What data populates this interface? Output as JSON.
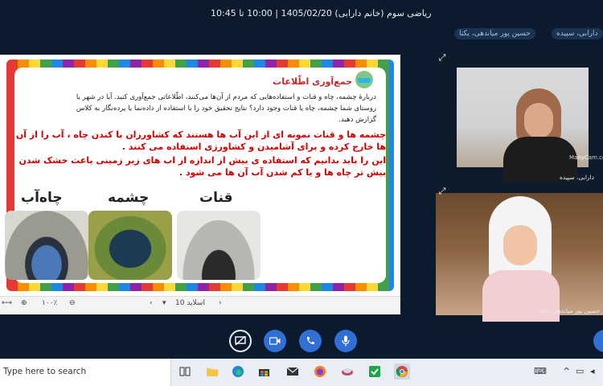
{
  "meeting": {
    "title": "ریاضی سوم (خانم دارابی) 1405/02/20 | 10:00 تا 10:45"
  },
  "participants_bar": {
    "chips": [
      "حسین پور میاندهی، یکتا",
      "دارابی، سپیده"
    ]
  },
  "slide": {
    "heading": "جمع‌آوری اطّلاعات",
    "paragraph": "دربارۀ چشمه، چاه و قنات و استفاده‌هایی که مردم از آن‌ها می‌کنند، اطّلاعاتی جمع‌آوری کنید. آیا در شهر یا روستای شما چشمه، چاه یا قنات وجود دارد؟ نتایج تحقیق خود را با استفاده از داده‌نما یا پرده‌نگار به کلاس گزارش دهید.",
    "red_text_1": "چشمه ها و قنات نمونه ای از این آب ها هستند که کشاورزان با کندن چاه ، آب را از آن ها خارج کرده و برای آشامیدن و کشاورزی استفاده می کنند .",
    "red_text_2": "این را باید بدانیم که استفاده ی بیش از اندازه از اب های زیر زمینی باعث خشک شدن بیش تر چاه ها و یا کم شدن آب آن ها می شود .",
    "labels": {
      "well": "چاه‌آب",
      "spring": "چشمه",
      "qanat": "قنات"
    }
  },
  "slide_toolbar": {
    "zoom": "۱۰۰٪",
    "slide_label": "اسلاید 10",
    "icons": [
      "fullscreen-arrows-icon",
      "zoom-in-icon",
      "zoom-out-icon",
      "chevron-left-icon",
      "chevron-down-icon",
      "chevron-right-icon"
    ]
  },
  "videos": [
    {
      "name": "دارابی، سپیده",
      "watermark": "ManyCam.com"
    },
    {
      "name": "حسین پور میاندهی، یکتا"
    }
  ],
  "controls": [
    "share-screen-off",
    "camera",
    "phone",
    "microphone",
    "more"
  ],
  "taskbar": {
    "search_placeholder": "Type here to search",
    "accent": "#2f6fd6"
  }
}
